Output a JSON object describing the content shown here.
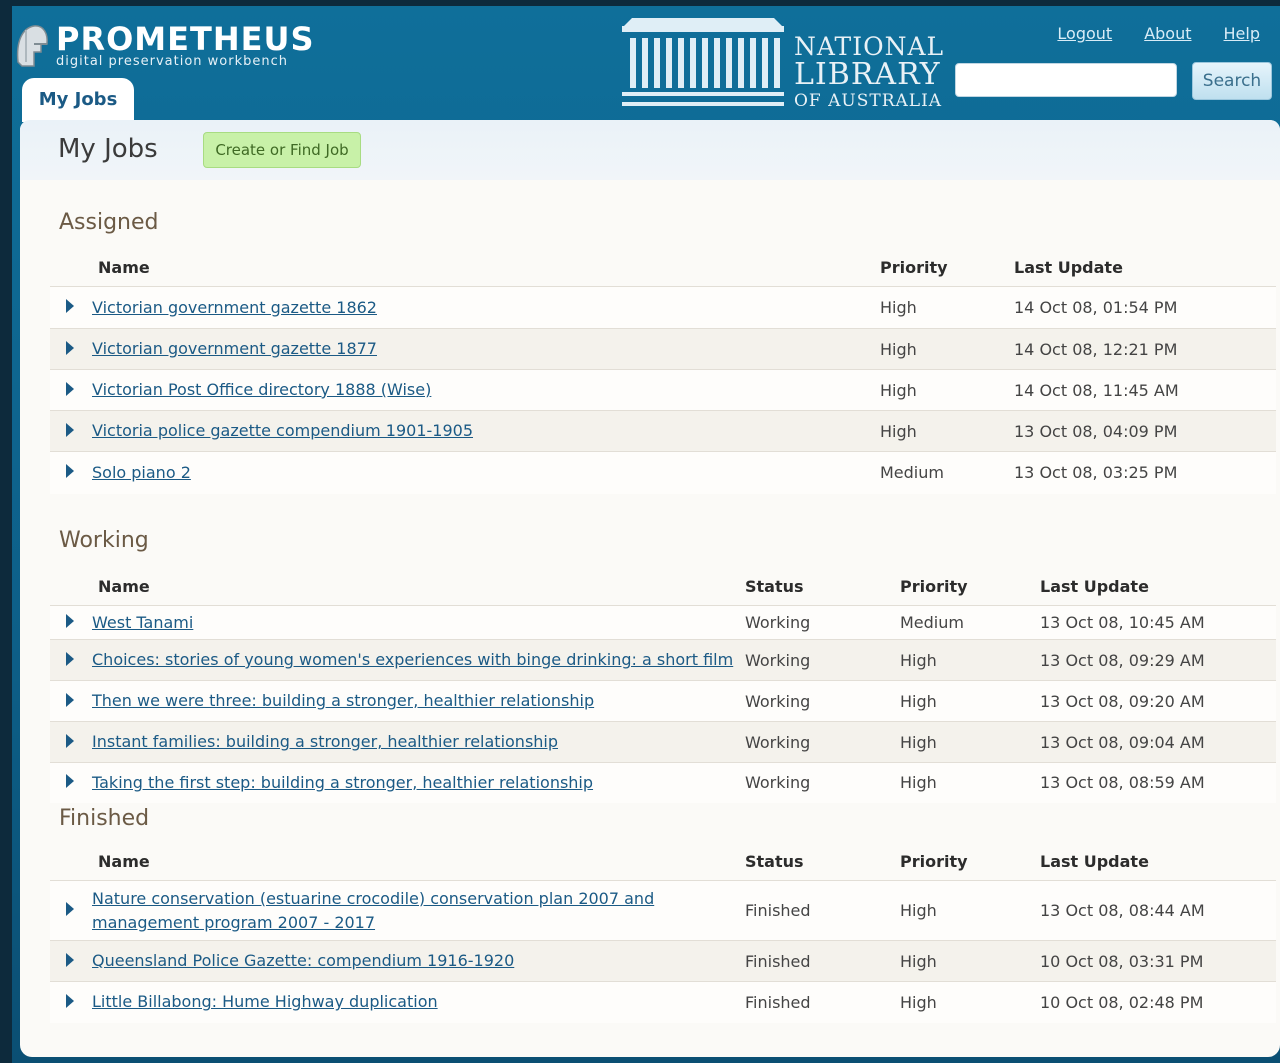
{
  "header": {
    "app_name": "PROMETHEUS",
    "app_subtitle": "digital preservation workbench",
    "library_line1": "NATIONAL",
    "library_line2": "LIBRARY",
    "library_line3": "OF AUSTRALIA",
    "links": {
      "logout": "Logout",
      "about": "About",
      "help": "Help"
    },
    "search": {
      "value": "",
      "placeholder": "",
      "button": "Search"
    },
    "active_tab": "My Jobs"
  },
  "page": {
    "title": "My Jobs",
    "create_button": "Create or Find Job"
  },
  "assigned": {
    "title": "Assigned",
    "columns": {
      "name": "Name",
      "priority": "Priority",
      "last_update": "Last Update"
    },
    "rows": [
      {
        "name": "Victorian government gazette 1862",
        "priority": "High",
        "last_update": "14 Oct 08, 01:54 PM"
      },
      {
        "name": "Victorian government gazette 1877",
        "priority": "High",
        "last_update": "14 Oct 08, 12:21 PM"
      },
      {
        "name": "Victorian Post Office directory 1888 (Wise)",
        "priority": "High",
        "last_update": "14 Oct 08, 11:45 AM"
      },
      {
        "name": "Victoria police gazette compendium 1901-1905",
        "priority": "High",
        "last_update": "13 Oct 08, 04:09 PM"
      },
      {
        "name": "Solo piano 2",
        "priority": "Medium",
        "last_update": "13 Oct 08, 03:25 PM"
      }
    ]
  },
  "working": {
    "title": "Working",
    "columns": {
      "name": "Name",
      "status": "Status",
      "priority": "Priority",
      "last_update": "Last Update"
    },
    "rows": [
      {
        "name": "West Tanami",
        "status": "Working",
        "priority": "Medium",
        "last_update": "13 Oct 08, 10:45 AM"
      },
      {
        "name": "Choices: stories of young women's experiences with binge drinking: a short film",
        "status": "Working",
        "priority": "High",
        "last_update": "13 Oct 08, 09:29 AM"
      },
      {
        "name": "Then we were three: building a stronger, healthier relationship",
        "status": "Working",
        "priority": "High",
        "last_update": "13 Oct 08, 09:20 AM"
      },
      {
        "name": "Instant families: building a stronger, healthier relationship",
        "status": "Working",
        "priority": "High",
        "last_update": "13 Oct 08, 09:04 AM"
      },
      {
        "name": "Taking the first step: building a stronger, healthier relationship",
        "status": "Working",
        "priority": "High",
        "last_update": "13 Oct 08, 08:59 AM"
      }
    ]
  },
  "finished": {
    "title": "Finished",
    "columns": {
      "name": "Name",
      "status": "Status",
      "priority": "Priority",
      "last_update": "Last Update"
    },
    "rows": [
      {
        "name": "Nature conservation (estuarine crocodile) conservation plan 2007 and management program 2007 - 2017",
        "status": "Finished",
        "priority": "High",
        "last_update": "13 Oct 08, 08:44 AM"
      },
      {
        "name": "Queensland Police Gazette: compendium 1916-1920",
        "status": "Finished",
        "priority": "High",
        "last_update": "10 Oct 08, 03:31 PM"
      },
      {
        "name": "Little Billabong: Hume Highway duplication",
        "status": "Finished",
        "priority": "High",
        "last_update": "10 Oct 08, 02:48 PM"
      }
    ]
  },
  "colors": {
    "header_blue": "#0f6f9a",
    "link_blue": "#1b5a85",
    "priority_high": "#f0a028",
    "create_button_green": "#c8f1a8"
  }
}
